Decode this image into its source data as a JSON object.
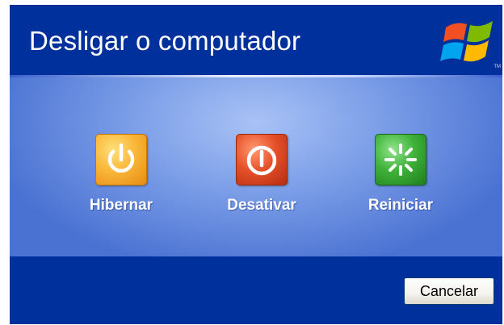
{
  "window": {
    "title": "Desligar o computador",
    "logo_icon": "windows-xp-flag-icon",
    "logo_trademark": "TM"
  },
  "options": [
    {
      "label": "Hibernar",
      "icon": "hibernate-power-icon",
      "color": "#f9b83a"
    },
    {
      "label": "Desativar",
      "icon": "shutdown-power-icon",
      "color": "#e6502a"
    },
    {
      "label": "Reiniciar",
      "icon": "restart-icon",
      "color": "#3fb23a"
    }
  ],
  "footer": {
    "cancel_label": "Cancelar"
  },
  "colors": {
    "header": "#00309c",
    "content_center": "#a9c2f6",
    "content_edge": "#4a72d2"
  }
}
